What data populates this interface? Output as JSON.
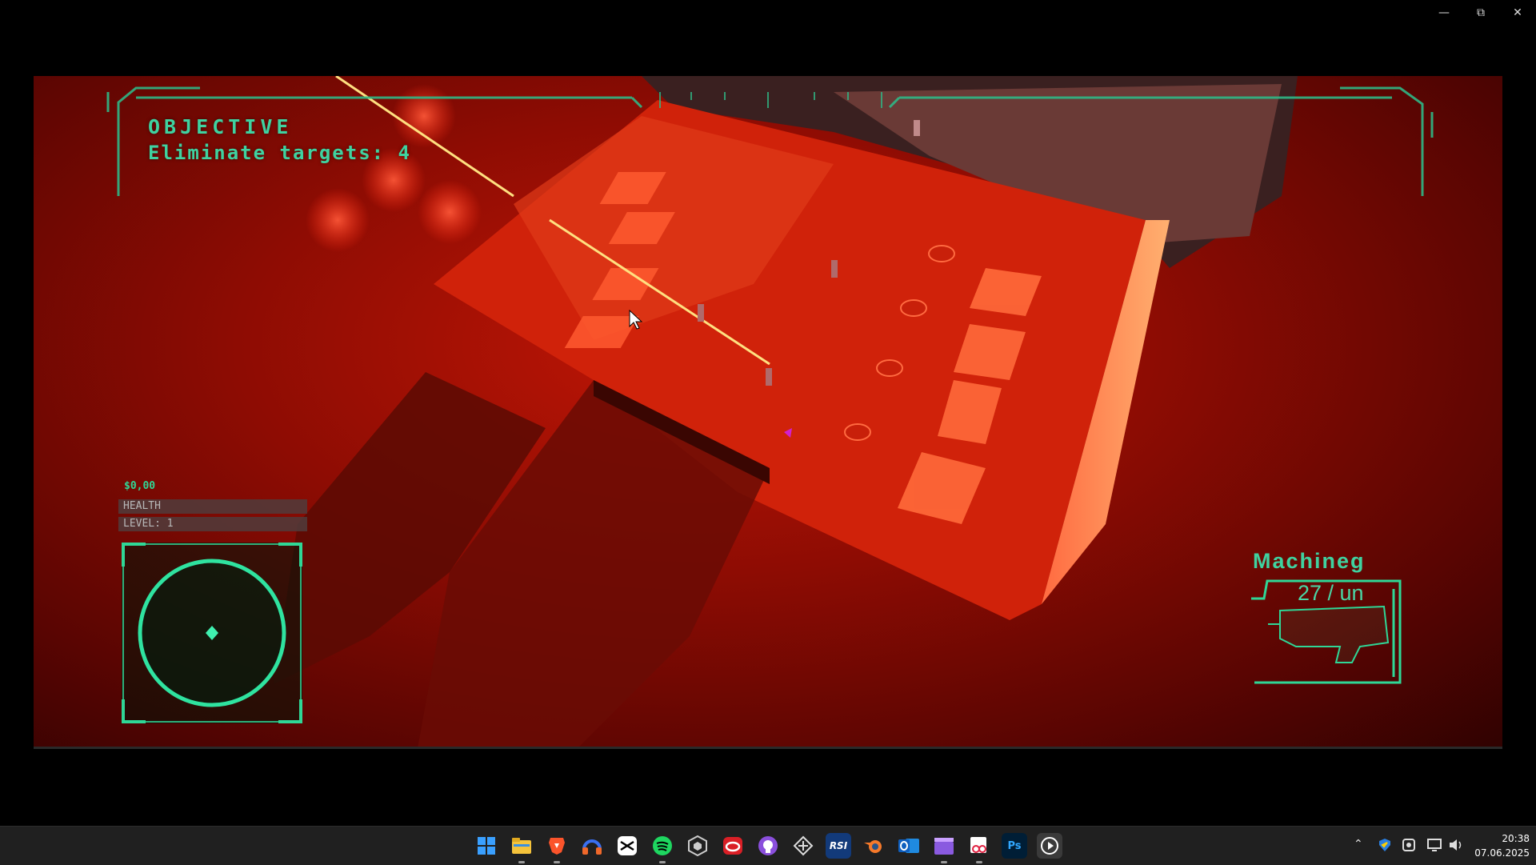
{
  "window": {
    "minimize_glyph": "—",
    "maximize_glyph": "⧉",
    "close_glyph": "✕"
  },
  "hud": {
    "objective_title": "OBJECTIVE",
    "objective_text": "Eliminate targets: 4",
    "money": "$0,00",
    "health_label": "HEALTH",
    "level_label": "LEVEL: 1",
    "weapon_name": "Machineg",
    "ammo": "27 / un",
    "accent_color": "#3fd2a0"
  },
  "taskbar": {
    "icons": [
      {
        "name": "windows-start-icon"
      },
      {
        "name": "file-explorer-icon"
      },
      {
        "name": "brave-browser-icon"
      },
      {
        "name": "headset-app-icon"
      },
      {
        "name": "capcut-icon"
      },
      {
        "name": "spotify-icon"
      },
      {
        "name": "unity-hub-icon"
      },
      {
        "name": "creative-cloud-icon"
      },
      {
        "name": "github-desktop-icon"
      },
      {
        "name": "tool-app-icon"
      },
      {
        "name": "rsi-launcher-icon",
        "text": "RSI"
      },
      {
        "name": "blender-icon"
      },
      {
        "name": "outlook-icon"
      },
      {
        "name": "clapper-app-icon"
      },
      {
        "name": "snipping-tool-icon"
      },
      {
        "name": "photoshop-icon",
        "text": "Ps"
      },
      {
        "name": "media-player-icon"
      }
    ],
    "clock_time": "20:38",
    "clock_date": "07.06.2025"
  }
}
